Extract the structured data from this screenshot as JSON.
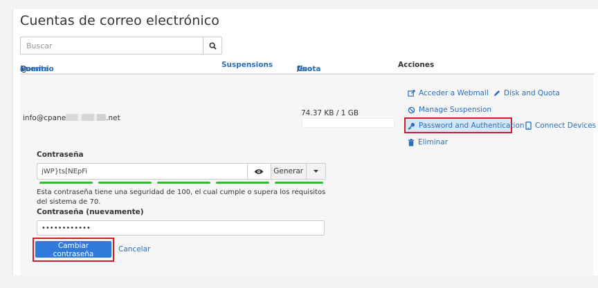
{
  "page": {
    "title": "Cuentas de correo electrónico",
    "search_placeholder": "Buscar"
  },
  "table": {
    "headers": {
      "account": "Cuenta",
      "sort_arrow": "▲",
      "at": "@",
      "domain": "Dominio",
      "suspensions": "Suspensions",
      "usage": "Uso",
      "quota": "Cuota",
      "percent": "%",
      "sep": "/",
      "actions": "Acciones"
    },
    "row": {
      "email_prefix": "info@cpane",
      "email_suffix": ".net",
      "usage": "74.37 KB / 1 GB",
      "actions": {
        "webmail": "Acceder a Webmail",
        "disk_quota": "Disk and Quota",
        "suspension": "Manage Suspension",
        "password_auth": "Password and Authentication",
        "connect_devices": "Connect Devices",
        "delete": "Eliminar"
      }
    }
  },
  "form": {
    "password_label": "Contraseña",
    "password_value": "jWP}ts[NEpFi",
    "generate_label": "Generar",
    "strength_hint": "Esta contraseña tiene una seguridad de 100, el cual cumple o supera los requisitos del sistema de 70.",
    "password_again_label": "Contraseña (nuevamente)",
    "password_again_value": "••••••••••••",
    "save_label": "Cambiar contraseña",
    "cancel_label": "Cancelar"
  },
  "colors": {
    "accent": "#2a6ebb",
    "primary_button": "#2f7ad8",
    "highlight_border": "#d11a2a",
    "strength": "#2ec02b"
  }
}
